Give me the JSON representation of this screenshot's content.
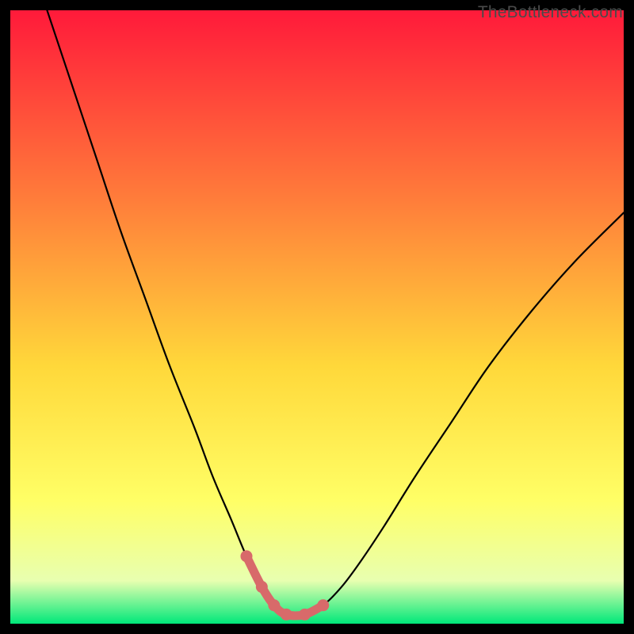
{
  "watermark": "TheBottleneck.com",
  "colors": {
    "frame": "#000000",
    "gradient_top": "#ff1a3a",
    "gradient_mid1": "#ff7a3a",
    "gradient_mid2": "#ffd83a",
    "gradient_mid3": "#ffff66",
    "gradient_bottom": "#00e87a",
    "curve": "#000000",
    "marker": "#d86a6a"
  },
  "chart_data": {
    "type": "line",
    "title": "",
    "xlabel": "",
    "ylabel": "",
    "xlim": [
      0,
      100
    ],
    "ylim": [
      0,
      100
    ],
    "grid": false,
    "legend": false,
    "series": [
      {
        "name": "bottleneck-curve",
        "x": [
          6,
          10,
          14,
          18,
          22,
          26,
          30,
          33,
          36,
          38.5,
          41,
          43,
          45,
          48,
          51,
          54,
          57,
          61,
          66,
          72,
          78,
          85,
          92,
          100
        ],
        "y": [
          100,
          88,
          76,
          64,
          53,
          42,
          32,
          24,
          17,
          11,
          6,
          3,
          1.5,
          1.5,
          3,
          6,
          10,
          16,
          24,
          33,
          42,
          51,
          59,
          67
        ]
      }
    ],
    "markers": {
      "name": "highlight-region",
      "x": [
        38.5,
        41,
        43,
        45,
        48,
        51
      ],
      "y": [
        11,
        6,
        3,
        1.5,
        1.5,
        3
      ]
    }
  }
}
